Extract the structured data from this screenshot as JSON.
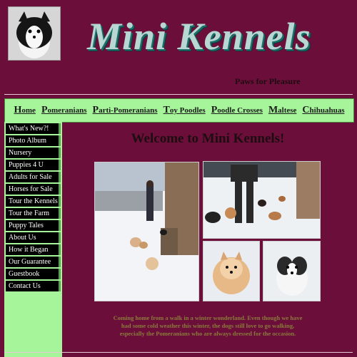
{
  "header": {
    "brand": "Mini Kennels",
    "tagline": "Paws for Pleasure"
  },
  "nav": [
    {
      "cap": "H",
      "rest": "ome"
    },
    {
      "cap": "P",
      "rest": "omeranians"
    },
    {
      "cap": "P",
      "rest": "arti-Pomeranians"
    },
    {
      "cap": "T",
      "rest": "oy Poodles"
    },
    {
      "cap": "P",
      "rest": "oodle Crosses"
    },
    {
      "cap": "M",
      "rest": "altese"
    },
    {
      "cap": "C",
      "rest": "hihuahuas"
    }
  ],
  "sidebar": [
    "What's New?!",
    "Photo Album",
    "Nursery",
    "Puppies 4 U",
    "Adults for Sale",
    "Horses for Sale",
    "Tour the Kennels",
    "Tour the Farm",
    "Puppy Tales",
    "About Us",
    "How it Began",
    "Our Guarantee",
    "Guestbook",
    "Contact Us"
  ],
  "main": {
    "title": "Welcome to Mini Kennels!",
    "caption_lines": [
      "Coming home from a walk in a winter wonderland. Even though we have",
      "had some cold weather this winter, the dogs still love to go walking,",
      "especially the Pomeranians who are always dressed for the occasion."
    ]
  }
}
